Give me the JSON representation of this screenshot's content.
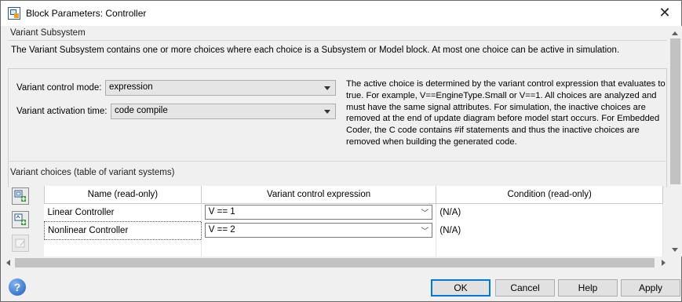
{
  "window": {
    "title": "Block Parameters: Controller"
  },
  "section": {
    "title": "Variant Subsystem",
    "description": "The Variant Subsystem contains one or more choices where each choice is a Subsystem or Model block. At most one choice can be active in simulation."
  },
  "form": {
    "control_mode_label": "Variant control mode:",
    "control_mode_value": "expression",
    "activation_time_label": "Variant activation time:",
    "activation_time_value": "code compile"
  },
  "help_text": "The active choice is determined by the variant control expression that evaluates to true. For example, V==EngineType.Small or V==1. All choices are analyzed and must have the same signal attributes. For simulation, the inactive choices are removed at the end of update diagram before model start occurs. For Embedded Coder,  the C code contains #if statements and thus the inactive choices are removed when building the generated code.",
  "choices": {
    "title": "Variant choices (table of variant systems)",
    "columns": [
      "Name (read-only)",
      "Variant control expression",
      "Condition (read-only)"
    ],
    "rows": [
      {
        "name": "Linear Controller",
        "expression": "V == 1",
        "condition": "(N/A)"
      },
      {
        "name": "Nonlinear Controller",
        "expression": "V == 2",
        "condition": "(N/A)"
      }
    ]
  },
  "buttons": {
    "ok": "OK",
    "cancel": "Cancel",
    "help": "Help",
    "apply": "Apply"
  },
  "colors": {
    "accent": "#0078d7",
    "background": "#f0f0f0"
  },
  "icons": {
    "app": "simulink-block-icon",
    "close": "close-icon",
    "add_subsystem": "add-subsystem-icon",
    "add_model": "add-model-block-icon",
    "edit": "edit-icon",
    "help": "help-icon"
  }
}
